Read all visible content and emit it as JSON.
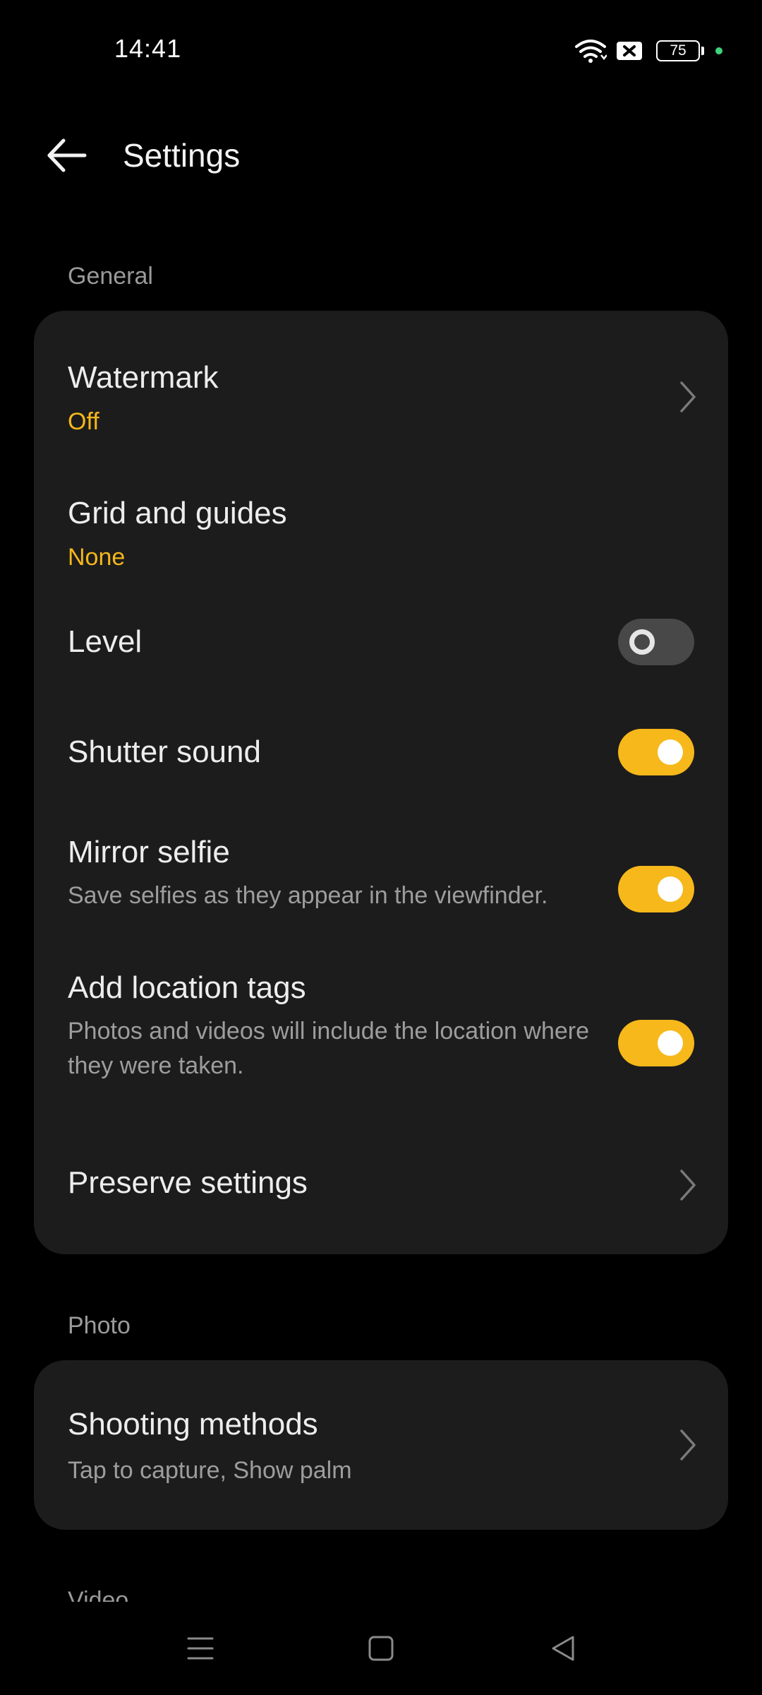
{
  "status": {
    "time": "14:41",
    "battery": "75"
  },
  "header": {
    "title": "Settings"
  },
  "sections": {
    "general": "General",
    "photo": "Photo",
    "video": "Video"
  },
  "general": {
    "watermark": {
      "title": "Watermark",
      "value": "Off"
    },
    "grid": {
      "title": "Grid and guides",
      "value": "None"
    },
    "level": {
      "title": "Level",
      "enabled": false
    },
    "shutter": {
      "title": "Shutter sound",
      "enabled": true
    },
    "mirror": {
      "title": "Mirror selfie",
      "desc": "Save selfies as they appear in the viewfinder.",
      "enabled": true
    },
    "location": {
      "title": "Add location tags",
      "desc": "Photos and videos will include the location where they were taken.",
      "enabled": true
    },
    "preserve": {
      "title": "Preserve settings"
    }
  },
  "photo": {
    "shooting": {
      "title": "Shooting methods",
      "desc": "Tap to capture, Show palm"
    }
  },
  "colors": {
    "accent": "#f6b81a",
    "card": "#1c1c1c",
    "background": "#000000"
  },
  "icons": [
    "wifi-icon",
    "sim-icon",
    "battery-icon",
    "back-arrow-icon",
    "chevron-right-icon",
    "menu-icon",
    "home-icon",
    "back-triangle-icon"
  ]
}
